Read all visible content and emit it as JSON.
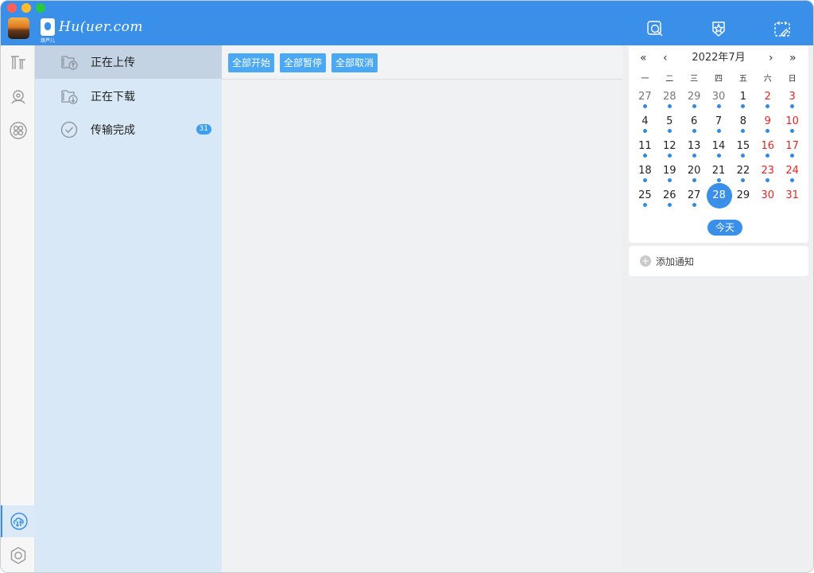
{
  "header": {
    "logo_text": "Hu(uer.com",
    "logo_sub": "葫芦儿"
  },
  "rail": {
    "items": [
      {
        "icon": "text-tool-icon"
      },
      {
        "icon": "user-network-icon"
      },
      {
        "icon": "apps-grid-icon"
      },
      {
        "icon": "cloud-transfer-icon"
      },
      {
        "icon": "settings-gear-icon"
      }
    ]
  },
  "nav": {
    "items": [
      {
        "label": "正在上传",
        "icon": "folder-upload-icon"
      },
      {
        "label": "正在下载",
        "icon": "folder-download-icon"
      },
      {
        "label": "传输完成",
        "icon": "check-circle-icon",
        "badge": "31"
      }
    ]
  },
  "toolbar": {
    "start_all": "全部开始",
    "pause_all": "全部暂停",
    "cancel_all": "全部取消"
  },
  "calendar": {
    "title": "2022年7月",
    "prev_year": "«",
    "prev_month": "‹",
    "next_month": "›",
    "next_year": "»",
    "weekdays": [
      "一",
      "二",
      "三",
      "四",
      "五",
      "六",
      "日"
    ],
    "weeks": [
      [
        "27",
        "28",
        "29",
        "30",
        "1",
        "2",
        "3"
      ],
      [
        "4",
        "5",
        "6",
        "7",
        "8",
        "9",
        "10"
      ],
      [
        "11",
        "12",
        "13",
        "14",
        "15",
        "16",
        "17"
      ],
      [
        "18",
        "19",
        "20",
        "21",
        "22",
        "23",
        "24"
      ],
      [
        "25",
        "26",
        "27",
        "28",
        "29",
        "30",
        "31"
      ]
    ],
    "today": "28",
    "today_label": "今天"
  },
  "notify": {
    "add_label": "添加通知"
  },
  "colors": {
    "accent": "#3a8fe9",
    "nav_bg": "#d8e8f7",
    "weekend": "#e22222"
  }
}
